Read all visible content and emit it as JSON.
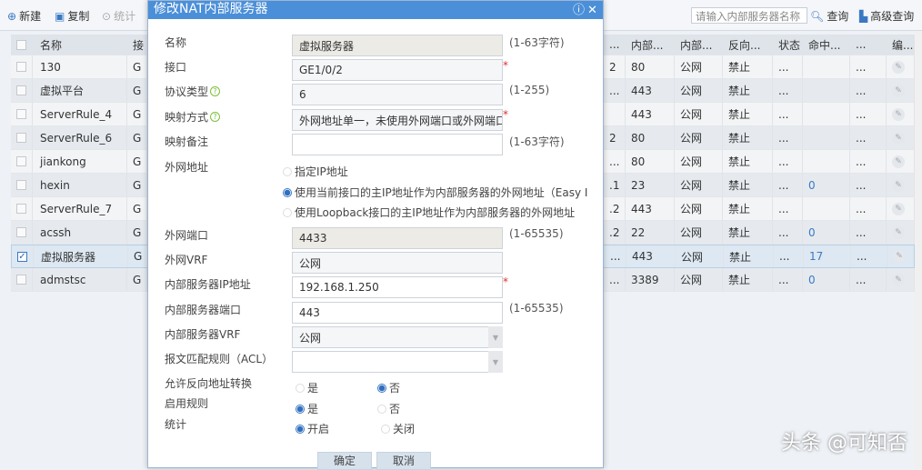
{
  "toolbar": {
    "new": "新建",
    "copy": "复制",
    "stats": "统计",
    "search_placeholder": "请输入内部服务器名称",
    "query": "查询",
    "advanced": "高级查询"
  },
  "table": {
    "headers": {
      "name": "名称",
      "iface": "接",
      "c_partial": "...",
      "inner_port": "内部...",
      "inner_vrf": "内部...",
      "reverse": "反向...",
      "status": "状态",
      "hit": "命中...",
      "more": "...",
      "edit": "编..."
    },
    "rows": [
      {
        "name": "130",
        "iface": "G",
        "partial": "2",
        "port": "80",
        "vrf": "公网",
        "reverse": "禁止",
        "status": "...",
        "hit": "",
        "more": "...",
        "checked": false
      },
      {
        "name": "虚拟平台",
        "iface": "G",
        "partial": "...",
        "port": "443",
        "vrf": "公网",
        "reverse": "禁止",
        "status": "...",
        "hit": "",
        "more": "...",
        "checked": false
      },
      {
        "name": "ServerRule_4",
        "iface": "G",
        "partial": "",
        "port": "443",
        "vrf": "公网",
        "reverse": "禁止",
        "status": "...",
        "hit": "",
        "more": "...",
        "checked": false
      },
      {
        "name": "ServerRule_6",
        "iface": "G",
        "partial": "2",
        "port": "80",
        "vrf": "公网",
        "reverse": "禁止",
        "status": "...",
        "hit": "",
        "more": "...",
        "checked": false
      },
      {
        "name": "jiankong",
        "iface": "G",
        "partial": "...",
        "port": "80",
        "vrf": "公网",
        "reverse": "禁止",
        "status": "...",
        "hit": "",
        "more": "...",
        "checked": false
      },
      {
        "name": "hexin",
        "iface": "G",
        "partial": ".1",
        "port": "23",
        "vrf": "公网",
        "reverse": "禁止",
        "status": "...",
        "hit": "0",
        "more": "...",
        "checked": false
      },
      {
        "name": "ServerRule_7",
        "iface": "G",
        "partial": ".2",
        "port": "443",
        "vrf": "公网",
        "reverse": "禁止",
        "status": "...",
        "hit": "",
        "more": "...",
        "checked": false
      },
      {
        "name": "acssh",
        "iface": "G",
        "partial": ".2",
        "port": "22",
        "vrf": "公网",
        "reverse": "禁止",
        "status": "...",
        "hit": "0",
        "more": "...",
        "checked": false
      },
      {
        "name": "虚拟服务器",
        "iface": "G",
        "partial": "...",
        "port": "443",
        "vrf": "公网",
        "reverse": "禁止",
        "status": "...",
        "hit": "17",
        "more": "...",
        "checked": true
      },
      {
        "name": "admstsc",
        "iface": "G",
        "partial": "...",
        "port": "3389",
        "vrf": "公网",
        "reverse": "禁止",
        "status": "...",
        "hit": "0",
        "more": "...",
        "checked": false
      }
    ]
  },
  "dialog": {
    "title": "修改NAT内部服务器",
    "name_label": "名称",
    "name_value": "虚拟服务器",
    "name_hint": "(1-63字符)",
    "iface_label": "接口",
    "iface_value": "GE1/0/2",
    "proto_label": "协议类型",
    "proto_value": "6",
    "proto_hint": "(1-255)",
    "map_label": "映射方式",
    "map_value": "外网地址单一，未使用外网端口或外网端口",
    "note_label": "映射备注",
    "note_value": "",
    "note_hint": "(1-63字符)",
    "ext_addr_label": "外网地址",
    "ext_opt1": "指定IP地址",
    "ext_opt2": "使用当前接口的主IP地址作为内部服务器的外网地址（Easy I",
    "ext_opt3": "使用Loopback接口的主IP地址作为内部服务器的外网地址",
    "ext_port_label": "外网端口",
    "ext_port_value": "4433",
    "ext_port_hint": "(1-65535)",
    "ext_vrf_label": "外网VRF",
    "ext_vrf_value": "公网",
    "in_ip_label": "内部服务器IP地址",
    "in_ip_value": "192.168.1.250",
    "in_port_label": "内部服务器端口",
    "in_port_value": "443",
    "in_port_hint": "(1-65535)",
    "in_vrf_label": "内部服务器VRF",
    "in_vrf_value": "公网",
    "acl_label": "报文匹配规则（ACL）",
    "acl_value": "",
    "reverse_label": "允许反向地址转换",
    "enable_label": "启用规则",
    "stats_label": "统计",
    "yes": "是",
    "no": "否",
    "on": "开启",
    "off": "关闭",
    "ok": "确定",
    "cancel": "取消"
  },
  "watermark": "头条 @可知否",
  "colors": {
    "title_bar": "#4b8fd8",
    "required": "#dd3333",
    "link": "#3b79c4"
  }
}
